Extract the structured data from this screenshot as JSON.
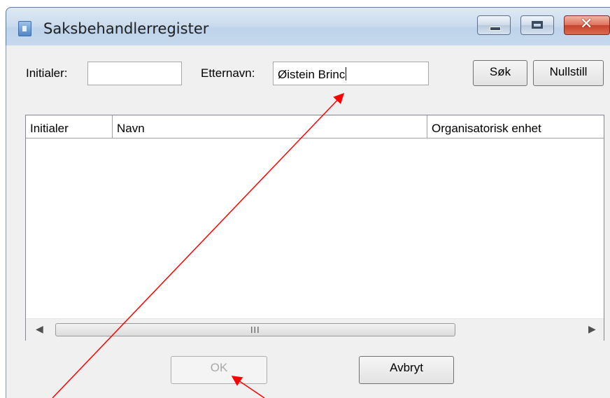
{
  "window": {
    "title": "Saksbehandlerregister"
  },
  "caption_buttons": {
    "minimize": "minimize-icon",
    "maximize": "maximize-icon",
    "close": "close-icon"
  },
  "search": {
    "initials_label": "Initialer:",
    "initials_value": "",
    "lastname_label": "Etternavn:",
    "lastname_value": "Øistein Brinc",
    "search_button": "Søk",
    "reset_button": "Nullstill"
  },
  "list": {
    "columns": [
      "Initialer",
      "Navn",
      "Organisatorisk enhet"
    ],
    "rows": [],
    "scroll_grip": "III"
  },
  "footer": {
    "ok_button": "OK",
    "ok_enabled": false,
    "cancel_button": "Avbryt"
  },
  "annotations": {
    "arrow_color": "#ff0000"
  }
}
